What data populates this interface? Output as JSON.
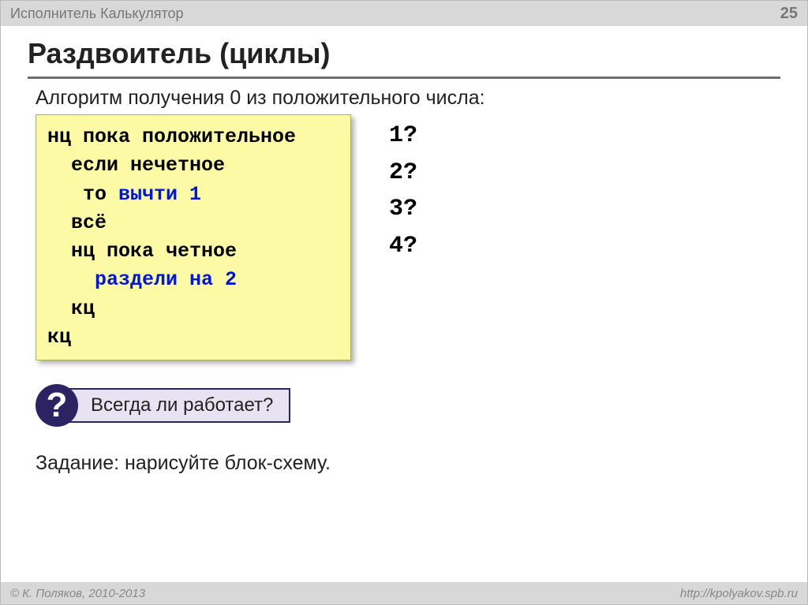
{
  "header": {
    "left": "Исполнитель Калькулятор",
    "page": "25"
  },
  "title": "Раздвоитель (циклы)",
  "description": "Алгоритм получения 0 из положительного числа:",
  "code": {
    "l1": "нц пока положительное",
    "l2": "  если нечетное",
    "l3a": "   то ",
    "l3b": "вычти 1",
    "l4": "  всё",
    "l5": "  нц пока четное",
    "l6": "    раздели на 2",
    "l7": "  кц",
    "l8": "кц"
  },
  "questions": {
    "q1": "1?",
    "q2": "2?",
    "q3": "3?",
    "q4": "4?"
  },
  "callout": {
    "symbol": "?",
    "text": "Всегда ли работает?"
  },
  "task": "Задание: нарисуйте блок-схему.",
  "footer": {
    "left": "© К. Поляков, 2010-2013",
    "right": "http://kpolyakov.spb.ru"
  }
}
